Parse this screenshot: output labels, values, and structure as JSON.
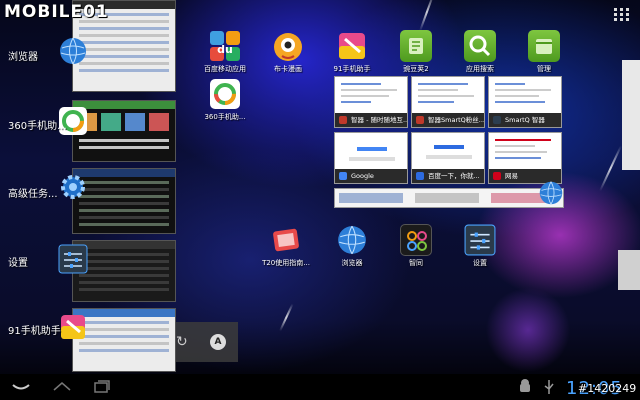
{
  "watermark": "MOBILE01",
  "watermark_id": "#1420249",
  "status": {
    "time": "12:05"
  },
  "recents": [
    {
      "label": "浏览器",
      "icon": "globe-icon"
    },
    {
      "label": "360手机助...",
      "icon": "360-assistant-icon"
    },
    {
      "label": "高级任务...",
      "icon": "gear-icon"
    },
    {
      "label": "设置",
      "icon": "settings-icon"
    },
    {
      "label": "91手机助手",
      "icon": "91-assistant-icon"
    }
  ],
  "home_apps_top": [
    {
      "label": "百度移动应用",
      "icon": "baidu-app-icon"
    },
    {
      "label": "布卡漫画",
      "icon": "buka-comic-icon"
    },
    {
      "label": "91手机助手",
      "icon": "91-assistant-icon"
    },
    {
      "label": "豌豆荚2",
      "icon": "wandoujia-icon"
    },
    {
      "label": "应用搜索",
      "icon": "app-search-icon"
    },
    {
      "label": "管理",
      "icon": "manager-icon"
    }
  ],
  "home_apps_row2": [
    {
      "label": "360手机助...",
      "icon": "360-assistant-icon"
    }
  ],
  "home_apps_bottom": [
    {
      "label": "T20使用指南...",
      "icon": "t20-guide-icon"
    },
    {
      "label": "浏览器",
      "icon": "globe-icon"
    },
    {
      "label": "智同",
      "icon": "zhitong-icon"
    },
    {
      "label": "设置",
      "icon": "settings-icon"
    }
  ],
  "browser_widget": {
    "tiles": [
      {
        "title": "智器 - 随时随地互...",
        "favicon": "#c0392b"
      },
      {
        "title": "智器SmartQ粉丝...",
        "favicon": "#c0392b"
      },
      {
        "title": "SmartQ 智器",
        "favicon": "#2c3e50"
      },
      {
        "title": "Google",
        "favicon": "#4285f4"
      },
      {
        "title": "百度一下，你就...",
        "favicon": "#2d6be0"
      },
      {
        "title": "网易",
        "favicon": "#d0021b"
      }
    ]
  },
  "colors": {
    "clock": "#4aa3ff",
    "accent": "#33b5e5"
  }
}
